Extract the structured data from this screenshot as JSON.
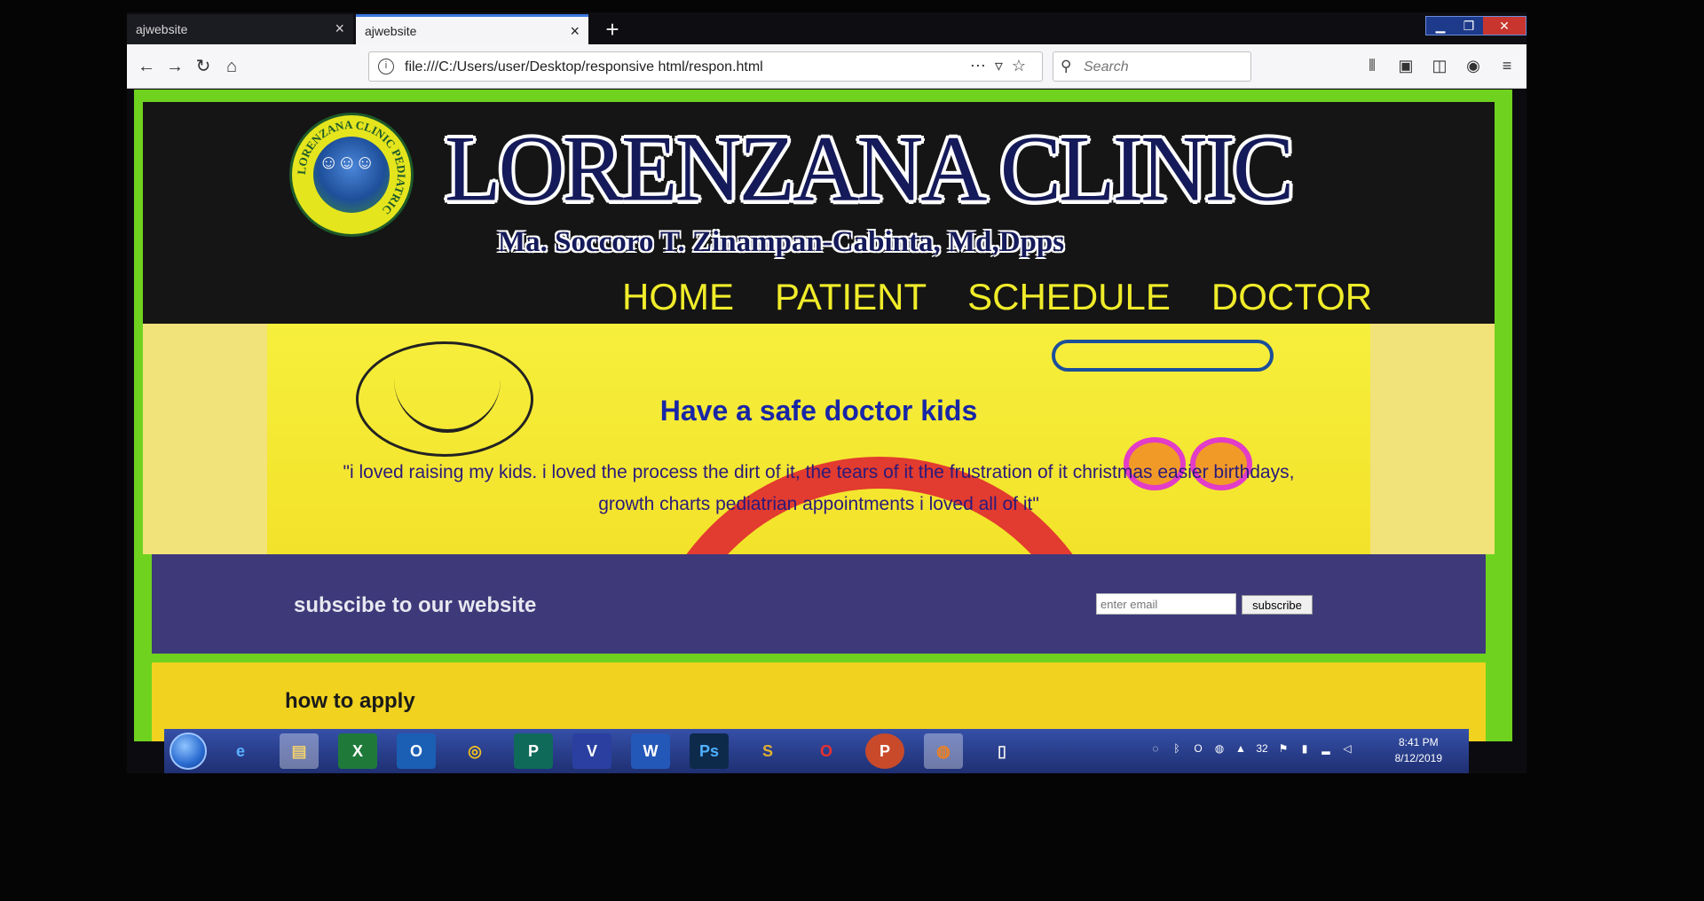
{
  "browser": {
    "tabs": [
      {
        "title": "ajwebsite",
        "active": false
      },
      {
        "title": "ajwebsite",
        "active": true
      }
    ],
    "url": "file:///C:/Users/user/Desktop/responsive html/respon.html",
    "search_placeholder": "Search"
  },
  "site": {
    "brand": "LORENZANA CLINIC",
    "subtitle": "Ma. Soccoro T. Zinampan-Cabinta, Md,Dpps",
    "logo_text": "LORENZANA CLINIC PEDIATRIC",
    "menu": [
      "HOME",
      "PATIENT",
      "SCHEDULE",
      "DOCTOR"
    ],
    "hero_heading": "Have a safe doctor kids",
    "quote_line1": "\"i loved raising my kids. i loved the process the dirt of it, the tears of it the frustration of it christmas easier birthdays,",
    "quote_line2": "growth charts pediatrian appointments i loved all of it\"",
    "subscribe_label": "subscibe to our website",
    "email_placeholder": "enter email",
    "subscribe_button": "subscribe",
    "apply_label": "how to apply"
  },
  "taskbar": {
    "time": "8:41 PM",
    "date": "8/12/2019",
    "tray_badge": "32"
  },
  "colors": {
    "page_border": "#6fd21f",
    "header_bg": "#151515",
    "menu_text": "#f0ec2a",
    "heading_blue": "#1826a6",
    "subscribe_bg": "#3e3a7a",
    "apply_bg": "#f0d21f"
  }
}
